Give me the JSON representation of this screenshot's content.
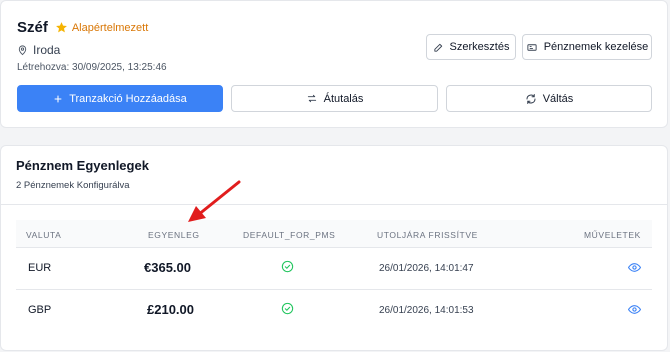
{
  "vault": {
    "title": "Széf",
    "default_label": "Alapértelmezett",
    "location": "Iroda",
    "created": "Létrehozva: 30/09/2025, 13:25:46"
  },
  "buttons": {
    "edit": "Szerkesztés",
    "manage_currencies": "Pénznemek kezelése",
    "add_transaction": "Tranzakció Hozzáadása",
    "transfer": "Átutalás",
    "exchange": "Váltás"
  },
  "balances": {
    "title": "Pénznem Egyenlegek",
    "subtitle": "2 Pénznemek Konfigurálva",
    "columns": {
      "currency": "VALUTA",
      "balance": "EGYENLEG",
      "default_for_pms": "DEFAULT_FOR_PMS",
      "last_updated": "UTOLJÁRA FRISSÍTVE",
      "actions": "MŰVELETEK"
    },
    "rows": [
      {
        "currency": "EUR",
        "balance": "€365.00",
        "default_for_pms": true,
        "last_updated": "26/01/2026, 14:01:47",
        "action_icon": "eye-icon"
      },
      {
        "currency": "GBP",
        "balance": "£210.00",
        "default_for_pms": true,
        "last_updated": "26/01/2026, 14:01:53",
        "action_icon": "eye-icon"
      }
    ]
  },
  "colors": {
    "accent": "#3b82f6",
    "star": "#f5b301",
    "default_label": "#d97706",
    "check": "#22c55e",
    "annotation_arrow": "#e11d1d"
  }
}
